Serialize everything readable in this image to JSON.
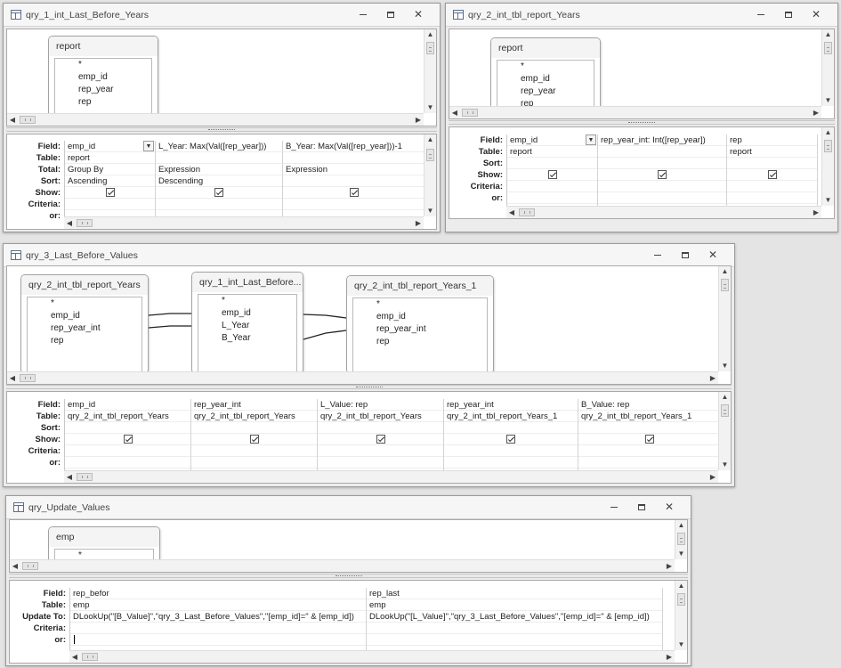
{
  "labels": {
    "field": "Field:",
    "table": "Table:",
    "total": "Total:",
    "sort": "Sort:",
    "show": "Show:",
    "criteria": "Criteria:",
    "or": "or:",
    "update_to": "Update To:"
  },
  "icons": {
    "window_icon": "query-icon",
    "minimize": "minimize-icon",
    "restore": "restore-icon",
    "close": "close-icon",
    "checkbox": "checkbox-checked-icon",
    "dropdown": "chevron-down-icon"
  },
  "colors": {
    "background": "#e4e4e4",
    "window": "#ececec",
    "pane": "#ffffff",
    "join_line": "#222222"
  },
  "glyphs": {
    "close": "✕",
    "up": "▲",
    "down": "▼",
    "left": "◀",
    "right": "▶"
  },
  "window1": {
    "title": "qry_1_int_Last_Before_Years",
    "table_box": {
      "name": "report",
      "fields": [
        "*",
        "emp_id",
        "rep_year",
        "rep"
      ]
    },
    "grid": {
      "columns": [
        {
          "field": "emp_id",
          "table": "report",
          "total": "Group By",
          "sort": "Ascending",
          "show": true,
          "criteria": "",
          "or": ""
        },
        {
          "field": "L_Year: Max(Val([rep_year]))",
          "table": "",
          "total": "Expression",
          "sort": "Descending",
          "show": true,
          "criteria": "",
          "or": ""
        },
        {
          "field": "B_Year: Max(Val([rep_year]))-1",
          "table": "",
          "total": "Expression",
          "sort": "",
          "show": true,
          "criteria": "",
          "or": ""
        }
      ]
    }
  },
  "window2": {
    "title": "qry_2_int_tbl_report_Years",
    "table_box": {
      "name": "report",
      "fields": [
        "*",
        "emp_id",
        "rep_year",
        "rep"
      ]
    },
    "grid": {
      "columns": [
        {
          "field": "emp_id",
          "table": "report",
          "sort": "",
          "show": true,
          "criteria": "",
          "or": ""
        },
        {
          "field": "rep_year_int: Int([rep_year])",
          "table": "",
          "sort": "",
          "show": true,
          "criteria": "",
          "or": ""
        },
        {
          "field": "rep",
          "table": "report",
          "sort": "",
          "show": true,
          "criteria": "",
          "or": ""
        }
      ]
    }
  },
  "window3": {
    "title": "qry_3_Last_Before_Values",
    "table_boxes": [
      {
        "name": "qry_2_int_tbl_report_Years",
        "fields": [
          "*",
          "emp_id",
          "rep_year_int",
          "rep"
        ]
      },
      {
        "name": "qry_1_int_Last_Before...",
        "fields": [
          "*",
          "emp_id",
          "L_Year",
          "B_Year"
        ]
      },
      {
        "name": "qry_2_int_tbl_report_Years_1",
        "fields": [
          "*",
          "emp_id",
          "rep_year_int",
          "rep"
        ]
      }
    ],
    "grid": {
      "columns": [
        {
          "field": "emp_id",
          "table": "qry_2_int_tbl_report_Years",
          "sort": "",
          "show": true,
          "criteria": "",
          "or": ""
        },
        {
          "field": "rep_year_int",
          "table": "qry_2_int_tbl_report_Years",
          "sort": "",
          "show": true,
          "criteria": "",
          "or": ""
        },
        {
          "field": "L_Value: rep",
          "table": "qry_2_int_tbl_report_Years",
          "sort": "",
          "show": true,
          "criteria": "",
          "or": ""
        },
        {
          "field": "rep_year_int",
          "table": "qry_2_int_tbl_report_Years_1",
          "sort": "",
          "show": true,
          "criteria": "",
          "or": ""
        },
        {
          "field": "B_Value: rep",
          "table": "qry_2_int_tbl_report_Years_1",
          "sort": "",
          "show": true,
          "criteria": "",
          "or": ""
        }
      ]
    }
  },
  "window4": {
    "title": "qry_Update_Values",
    "table_box": {
      "name": "emp",
      "fields": [
        "*"
      ]
    },
    "grid": {
      "columns": [
        {
          "field": "rep_befor",
          "table": "emp",
          "update_to": "DLookUp(\"[B_Value]\",\"qry_3_Last_Before_Values\",\"[emp_id]=\" & [emp_id])",
          "criteria": "",
          "or": ""
        },
        {
          "field": "rep_last",
          "table": "emp",
          "update_to": "DLookUp(\"[L_Value]\",\"qry_3_Last_Before_Values\",\"[emp_id]=\" & [emp_id])",
          "criteria": "",
          "or": ""
        }
      ]
    }
  }
}
